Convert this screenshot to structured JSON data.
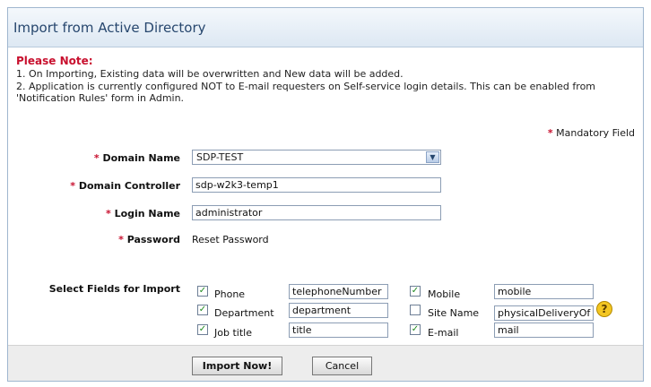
{
  "title": "Import from Active Directory",
  "note": {
    "heading": "Please Note:",
    "line1": "1. On Importing, Existing data will be overwritten and New data will be added.",
    "line2": "2. Application is currently configured NOT to E-mail requesters on Self-service login details. This can be enabled from",
    "line3": "'Notification Rules' form in Admin."
  },
  "mandatory_note": "Mandatory Field",
  "form": {
    "domain_name": {
      "label": "Domain Name",
      "value": "SDP-TEST"
    },
    "domain_controller": {
      "label": "Domain Controller",
      "value": "sdp-w2k3-temp1"
    },
    "login_name": {
      "label": "Login Name",
      "value": "administrator"
    },
    "password": {
      "label": "Password",
      "value": "Reset Password"
    }
  },
  "select_fields_label": "Select Fields for Import",
  "fields": {
    "phone": {
      "label": "Phone",
      "value": "telephoneNumber",
      "checked": true
    },
    "department": {
      "label": "Department",
      "value": "department",
      "checked": true
    },
    "job_title": {
      "label": "Job title",
      "value": "title",
      "checked": true
    },
    "mobile": {
      "label": "Mobile",
      "value": "mobile",
      "checked": true
    },
    "site_name": {
      "label": "Site Name",
      "value": "physicalDeliveryOf",
      "checked": false
    },
    "email": {
      "label": "E-mail",
      "value": "mail",
      "checked": true
    }
  },
  "buttons": {
    "import": "Import Now!",
    "cancel": "Cancel"
  },
  "colors": {
    "required_star": "#c8102e",
    "title_text": "#27476e",
    "help_icon": "#f3c622"
  }
}
